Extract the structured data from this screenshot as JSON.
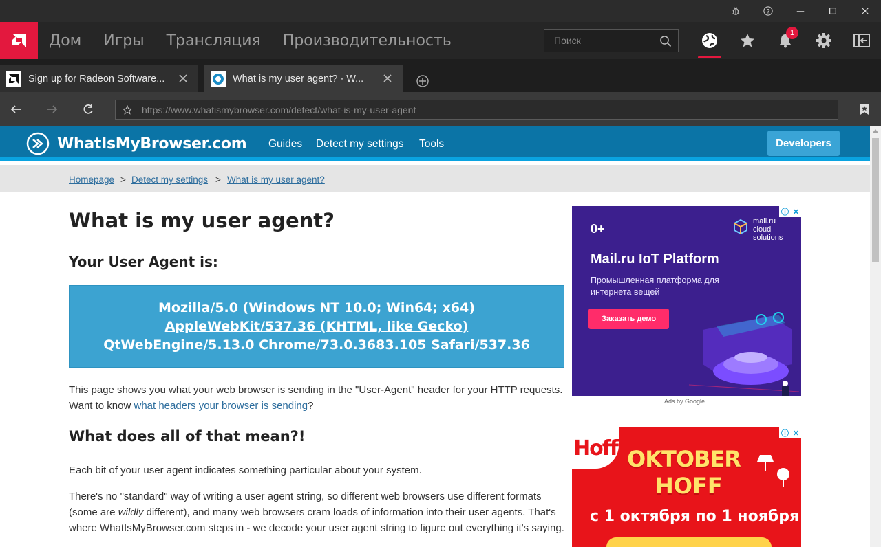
{
  "app": {
    "nav": [
      "Дом",
      "Игры",
      "Трансляция",
      "Производительность"
    ],
    "search_placeholder": "Поиск",
    "notification_count": "1",
    "accent": "#e3183e"
  },
  "tabs": [
    {
      "title": "Sign up for Radeon Software...",
      "active": false
    },
    {
      "title": "What is my user agent? - W...",
      "active": true
    }
  ],
  "address": {
    "url": "https://www.whatismybrowser.com/detect/what-is-my-user-agent"
  },
  "site": {
    "name": "WhatIsMyBrowser.com",
    "nav": [
      "Guides",
      "Detect my settings",
      "Tools"
    ],
    "developers": "Developers",
    "breadcrumb": [
      "Homepage",
      "Detect my settings",
      "What is my user agent?"
    ],
    "breadcrumb_sep": ">"
  },
  "content": {
    "title": "What is my user agent?",
    "ua_heading": "Your User Agent is:",
    "user_agent": "Mozilla/5.0 (Windows NT 10.0; Win64; x64) AppleWebKit/537.36 (KHTML, like Gecko) QtWebEngine/5.13.0 Chrome/73.0.3683.105 Safari/537.36",
    "p1_a": "This page shows you what your web browser is sending in the \"User-Agent\" header for your HTTP requests. Want to know ",
    "p1_link": "what headers your browser is sending",
    "p1_b": "?",
    "h_meaning": "What does all of that mean?!",
    "p2": "Each bit of your user agent indicates something particular about your system.",
    "p3_a": "There's no \"standard\" way of writing a user agent string, so different web browsers use different formats (some are ",
    "p3_em": "wildly",
    "p3_b": " different), and many web browsers cram loads of information into their user agents. That's where WhatIsMyBrowser.com steps in - we decode your user agent string to figure out everything it's saying."
  },
  "ads": {
    "ad1": {
      "age": "0+",
      "brand": "mail.ru cloud solutions",
      "title": "Mail.ru IoT Platform",
      "subtitle": "Промышленная платформа для интернета вещей",
      "cta": "Заказать демо"
    },
    "ads_by": "Ads by Google",
    "ad2": {
      "logo": "Hoff",
      "line1": "OKTOBER",
      "line2": "HOFF",
      "dates": "с 1 октября по 1 ноября"
    }
  }
}
